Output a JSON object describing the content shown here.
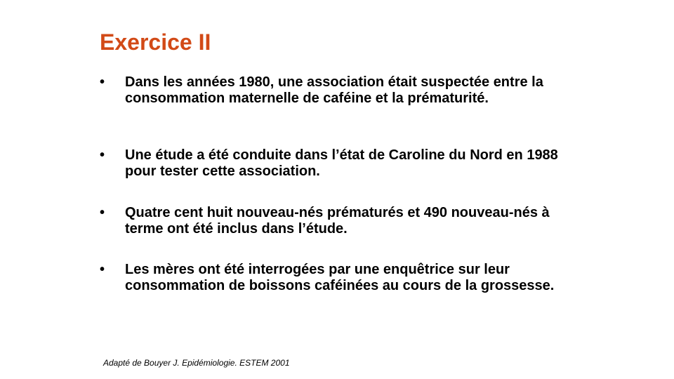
{
  "slide": {
    "title": "Exercice II",
    "title_color": "#d24a17",
    "bullet_symbol": "•",
    "bullets": [
      "Dans les années 1980, une association était suspectée entre la consommation maternelle de caféine et la prématurité.",
      "Une étude a été conduite dans l’état de Caroline du Nord en 1988 pour tester cette association.",
      "Quatre cent huit nouveau-nés prématurés et 490 nouveau-nés à terme ont été inclus dans l’étude.",
      "Les mères ont été interrogées par une enquêtrice sur leur consommation de boissons caféinées au cours de la grossesse."
    ],
    "source": "Adapté de Bouyer J. Epidémiologie. ESTEM 2001"
  }
}
